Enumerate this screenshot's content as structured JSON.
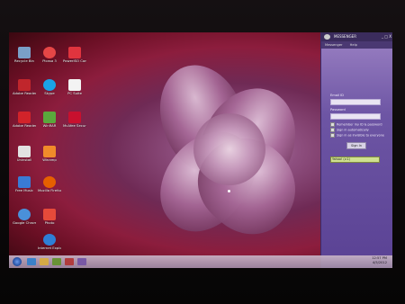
{
  "desktop": {
    "icons": [
      {
        "label": "Recycle Bin",
        "color": "#7aa0c8"
      },
      {
        "label": "Picasa 3",
        "color": "#e54646"
      },
      {
        "label": "PowerISO Connect",
        "color": "#e0343e"
      },
      {
        "label": "Adobe Reader",
        "color": "#c0262c"
      },
      {
        "label": "Skype",
        "color": "#1aa3e8"
      },
      {
        "label": "PC Suite",
        "color": "#f3f3f3"
      },
      {
        "label": "Adobe Reader X",
        "color": "#d2232a"
      },
      {
        "label": "WinRAR",
        "color": "#5aa83c"
      },
      {
        "label": "McAfee Security",
        "color": "#c8102e"
      },
      {
        "label": "Uninstall",
        "color": "#e2e2e2"
      },
      {
        "label": "Winamp",
        "color": "#f08b2a"
      },
      {
        "label": "Free Music",
        "color": "#3a7bd5"
      },
      {
        "label": "Mozilla Firefox",
        "color": "#e66000"
      },
      {
        "label": "Google Chrome",
        "color": "#4a90d9"
      },
      {
        "label": "Photo",
        "color": "#e64a3a"
      },
      {
        "label": "Internet Explorer",
        "color": "#2e7fd6"
      }
    ]
  },
  "messenger": {
    "title": "MESSENGER",
    "window_controls": "_ □ X",
    "menu": [
      "Messenger",
      "Help"
    ],
    "email_label": "Email ID",
    "password_label": "Password",
    "email_value": "",
    "password_value": "",
    "options": [
      "Remember my ID & password",
      "Sign in automatically",
      "Sign in as invisible to everyone"
    ],
    "signin_button": "Sign In",
    "network_value": "Yahoo! (v.1)"
  },
  "taskbar": {
    "clock_time": "12:57 PM",
    "clock_date": "4/5/2012"
  },
  "colors": {
    "messenger_bg": "#6d55a4",
    "taskbar_bg": "#b8a3bb",
    "wallpaper_accent": "#8c1d3d"
  }
}
